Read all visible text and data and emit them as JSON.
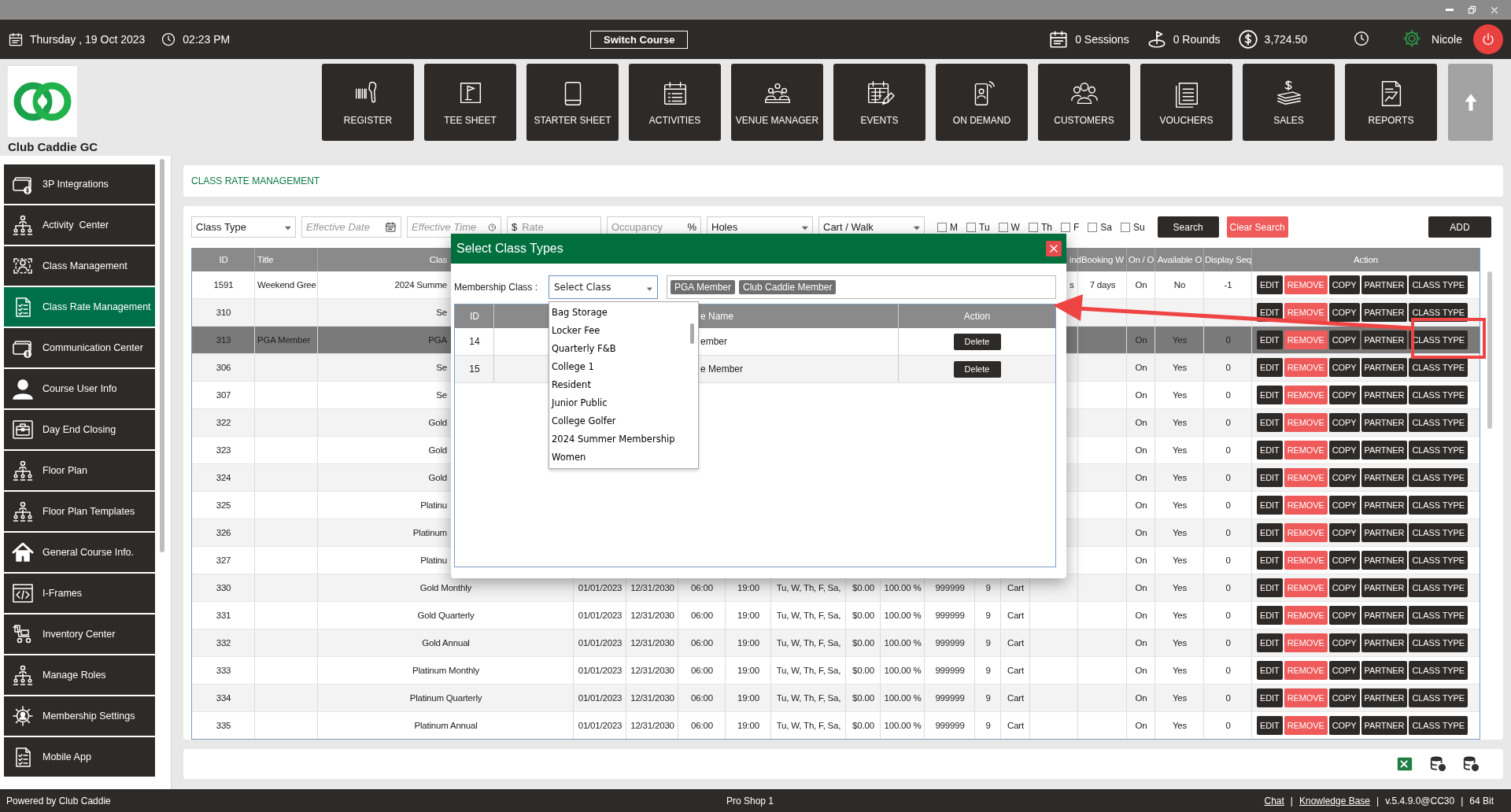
{
  "header": {
    "date": "Thursday , 19 Oct 2023",
    "time": "02:23 PM",
    "switch_course": "Switch Course",
    "sessions": "0 Sessions",
    "rounds": "0 Rounds",
    "balance": "3,724.50",
    "user": "Nicole"
  },
  "brand": {
    "name": "Club Caddie GC"
  },
  "nav": [
    "REGISTER",
    "TEE SHEET",
    "STARTER SHEET",
    "ACTIVITIES",
    "VENUE MANAGER",
    "EVENTS",
    "ON DEMAND",
    "CUSTOMERS",
    "VOUCHERS",
    "SALES",
    "REPORTS"
  ],
  "sidebar": {
    "items": [
      {
        "label": "3P Integrations",
        "selected": false
      },
      {
        "label": "Activity  Center",
        "selected": false
      },
      {
        "label": "Class Management",
        "selected": false
      },
      {
        "label": "Class Rate Management",
        "selected": true
      },
      {
        "label": "Communication Center",
        "selected": false
      },
      {
        "label": "Course User Info",
        "selected": false
      },
      {
        "label": "Day End Closing",
        "selected": false
      },
      {
        "label": "Floor Plan",
        "selected": false
      },
      {
        "label": "Floor Plan Templates",
        "selected": false
      },
      {
        "label": "General Course Info.",
        "selected": false
      },
      {
        "label": "I-Frames",
        "selected": false
      },
      {
        "label": "Inventory Center",
        "selected": false
      },
      {
        "label": "Manage Roles",
        "selected": false
      },
      {
        "label": "Membership Settings",
        "selected": false
      },
      {
        "label": "Mobile App",
        "selected": false
      }
    ]
  },
  "page_title": "CLASS RATE MANAGEMENT",
  "filters": {
    "class_type": "Class Type",
    "effective_date": {
      "placeholder": "Effective Date"
    },
    "effective_time": {
      "placeholder": "Effective Time"
    },
    "rate": {
      "prefix": "$",
      "placeholder": "Rate"
    },
    "occupancy": {
      "placeholder": "Occupancy",
      "suffix": "%"
    },
    "holes": "Holes",
    "cart_walk": "Cart / Walk",
    "days": [
      {
        "label": "M",
        "checked": false
      },
      {
        "label": "Tu",
        "checked": false
      },
      {
        "label": "W",
        "checked": false
      },
      {
        "label": "Th",
        "checked": false
      },
      {
        "label": "F",
        "checked": false
      },
      {
        "label": "Sa",
        "checked": false
      },
      {
        "label": "Su",
        "checked": false
      }
    ],
    "search": "Search",
    "clear_search": "Clear Search",
    "add": "ADD"
  },
  "table": {
    "columns": [
      "ID",
      "Title",
      "Clas",
      "ind",
      "Booking W",
      "On / O",
      "Available O",
      "Display Seq",
      "Action"
    ],
    "rows": [
      {
        "id": "1591",
        "title": "Weekend Gree",
        "class": "2024 Summe",
        "column_14": "s",
        "column_15": "7 days",
        "column_16": "On",
        "column_17": "No",
        "column_18": "-1",
        "selected": false,
        "actions": [
          {
            "label": "EDIT",
            "kind": "dark"
          },
          {
            "label": "REMOVE",
            "kind": "danger"
          },
          {
            "label": "COPY",
            "kind": "dark"
          },
          {
            "label": "PARTNER",
            "kind": "dark"
          },
          {
            "label": "CLASS TYPE",
            "kind": "dark"
          }
        ]
      },
      {
        "id": "310",
        "class": "Se",
        "selected": false,
        "actions": [
          {
            "label": "EDIT",
            "kind": "dark"
          },
          {
            "label": "REMOVE",
            "kind": "danger"
          },
          {
            "label": "COPY",
            "kind": "dark"
          },
          {
            "label": "PARTNER",
            "kind": "dark"
          },
          {
            "label": "CLASS TYPE",
            "kind": "dark"
          }
        ]
      },
      {
        "id": "313",
        "title": "PGA Member",
        "class": "PGA",
        "column_16": "On",
        "column_17": "Yes",
        "column_18": "0",
        "selected": true,
        "actions": [
          {
            "label": "EDIT",
            "kind": "dark"
          },
          {
            "label": "REMOVE",
            "kind": "danger"
          },
          {
            "label": "COPY",
            "kind": "dark"
          },
          {
            "label": "PARTNER",
            "kind": "dark"
          },
          {
            "label": "CLASS TYPE",
            "kind": "dark"
          }
        ]
      },
      {
        "id": "306",
        "class": "Se",
        "column_16": "On",
        "column_17": "Yes",
        "column_18": "0",
        "selected": false,
        "actions": [
          {
            "label": "EDIT",
            "kind": "dark"
          },
          {
            "label": "REMOVE",
            "kind": "danger"
          },
          {
            "label": "COPY",
            "kind": "dark"
          },
          {
            "label": "PARTNER",
            "kind": "dark"
          },
          {
            "label": "CLASS TYPE",
            "kind": "dark"
          }
        ]
      },
      {
        "id": "307",
        "class": "Se",
        "column_16": "On",
        "column_17": "Yes",
        "column_18": "0",
        "selected": false,
        "actions": [
          {
            "label": "EDIT",
            "kind": "dark"
          },
          {
            "label": "REMOVE",
            "kind": "danger"
          },
          {
            "label": "COPY",
            "kind": "dark"
          },
          {
            "label": "PARTNER",
            "kind": "dark"
          },
          {
            "label": "CLASS TYPE",
            "kind": "dark"
          }
        ]
      },
      {
        "id": "322",
        "class": "Gold",
        "column_16": "On",
        "column_17": "Yes",
        "column_18": "0",
        "selected": false,
        "actions": [
          {
            "label": "EDIT",
            "kind": "dark"
          },
          {
            "label": "REMOVE",
            "kind": "danger"
          },
          {
            "label": "COPY",
            "kind": "dark"
          },
          {
            "label": "PARTNER",
            "kind": "dark"
          },
          {
            "label": "CLASS TYPE",
            "kind": "dark"
          }
        ]
      },
      {
        "id": "323",
        "class": "Gold",
        "column_16": "On",
        "column_17": "Yes",
        "column_18": "0",
        "selected": false,
        "actions": [
          {
            "label": "EDIT",
            "kind": "dark"
          },
          {
            "label": "REMOVE",
            "kind": "danger"
          },
          {
            "label": "COPY",
            "kind": "dark"
          },
          {
            "label": "PARTNER",
            "kind": "dark"
          },
          {
            "label": "CLASS TYPE",
            "kind": "dark"
          }
        ]
      },
      {
        "id": "324",
        "class": "Gold",
        "column_16": "On",
        "column_17": "Yes",
        "column_18": "0",
        "selected": false,
        "actions": [
          {
            "label": "EDIT",
            "kind": "dark"
          },
          {
            "label": "REMOVE",
            "kind": "danger"
          },
          {
            "label": "COPY",
            "kind": "dark"
          },
          {
            "label": "PARTNER",
            "kind": "dark"
          },
          {
            "label": "CLASS TYPE",
            "kind": "dark"
          }
        ]
      },
      {
        "id": "325",
        "class": "Platinu",
        "column_16": "On",
        "column_17": "Yes",
        "column_18": "0",
        "selected": false,
        "actions": [
          {
            "label": "EDIT",
            "kind": "dark"
          },
          {
            "label": "REMOVE",
            "kind": "danger"
          },
          {
            "label": "COPY",
            "kind": "dark"
          },
          {
            "label": "PARTNER",
            "kind": "dark"
          },
          {
            "label": "CLASS TYPE",
            "kind": "dark"
          }
        ]
      },
      {
        "id": "326",
        "class": "Platinum",
        "column_16": "On",
        "column_17": "Yes",
        "column_18": "0",
        "selected": false,
        "actions": [
          {
            "label": "EDIT",
            "kind": "dark"
          },
          {
            "label": "REMOVE",
            "kind": "danger"
          },
          {
            "label": "COPY",
            "kind": "dark"
          },
          {
            "label": "PARTNER",
            "kind": "dark"
          },
          {
            "label": "CLASS TYPE",
            "kind": "dark"
          }
        ]
      },
      {
        "id": "327",
        "class": "Platinu",
        "column_16": "On",
        "column_17": "Yes",
        "column_18": "0",
        "selected": false,
        "actions": [
          {
            "label": "EDIT",
            "kind": "dark"
          },
          {
            "label": "REMOVE",
            "kind": "danger"
          },
          {
            "label": "COPY",
            "kind": "dark"
          },
          {
            "label": "PARTNER",
            "kind": "dark"
          },
          {
            "label": "CLASS TYPE",
            "kind": "dark"
          }
        ]
      },
      {
        "id": "330",
        "class": "Gold Monthly",
        "column_4": "01/01/2023",
        "column_5": "12/31/2030",
        "column_6": "06:00",
        "column_7": "19:00",
        "column_8": "Tu, W, Th, F, Sa,",
        "column_9": "$0.00",
        "column_10": "100.00 %",
        "column_11": "999999",
        "column_12": "9",
        "column_13": "Cart",
        "column_16": "On",
        "column_17": "Yes",
        "column_18": "0",
        "selected": false,
        "actions": [
          {
            "label": "EDIT",
            "kind": "dark"
          },
          {
            "label": "REMOVE",
            "kind": "danger"
          },
          {
            "label": "COPY",
            "kind": "dark"
          },
          {
            "label": "PARTNER",
            "kind": "dark"
          },
          {
            "label": "CLASS TYPE",
            "kind": "dark"
          }
        ]
      },
      {
        "id": "331",
        "class": "Gold Quarterly",
        "column_4": "01/01/2023",
        "column_5": "12/31/2030",
        "column_6": "06:00",
        "column_7": "19:00",
        "column_8": "Tu, W, Th, F, Sa,",
        "column_9": "$0.00",
        "column_10": "100.00 %",
        "column_11": "999999",
        "column_12": "9",
        "column_13": "Cart",
        "column_16": "On",
        "column_17": "Yes",
        "column_18": "0",
        "selected": false,
        "actions": [
          {
            "label": "EDIT",
            "kind": "dark"
          },
          {
            "label": "REMOVE",
            "kind": "danger"
          },
          {
            "label": "COPY",
            "kind": "dark"
          },
          {
            "label": "PARTNER",
            "kind": "dark"
          },
          {
            "label": "CLASS TYPE",
            "kind": "dark"
          }
        ]
      },
      {
        "id": "332",
        "class": "Gold Annual",
        "column_4": "01/01/2023",
        "column_5": "12/31/2030",
        "column_6": "06:00",
        "column_7": "19:00",
        "column_8": "Tu, W, Th, F, Sa,",
        "column_9": "$0.00",
        "column_10": "100.00 %",
        "column_11": "999999",
        "column_12": "9",
        "column_13": "Cart",
        "column_16": "On",
        "column_17": "Yes",
        "column_18": "0",
        "selected": false,
        "actions": [
          {
            "label": "EDIT",
            "kind": "dark"
          },
          {
            "label": "REMOVE",
            "kind": "danger"
          },
          {
            "label": "COPY",
            "kind": "dark"
          },
          {
            "label": "PARTNER",
            "kind": "dark"
          },
          {
            "label": "CLASS TYPE",
            "kind": "dark"
          }
        ]
      },
      {
        "id": "333",
        "class": "Platinum Monthly",
        "column_4": "01/01/2023",
        "column_5": "12/31/2030",
        "column_6": "06:00",
        "column_7": "19:00",
        "column_8": "Tu, W, Th, F, Sa,",
        "column_9": "$0.00",
        "column_10": "100.00 %",
        "column_11": "999999",
        "column_12": "9",
        "column_13": "Cart",
        "column_16": "On",
        "column_17": "Yes",
        "column_18": "0",
        "selected": false,
        "actions": [
          {
            "label": "EDIT",
            "kind": "dark"
          },
          {
            "label": "REMOVE",
            "kind": "danger"
          },
          {
            "label": "COPY",
            "kind": "dark"
          },
          {
            "label": "PARTNER",
            "kind": "dark"
          },
          {
            "label": "CLASS TYPE",
            "kind": "dark"
          }
        ]
      },
      {
        "id": "334",
        "class": "Platinum Quarterly",
        "column_4": "01/01/2023",
        "column_5": "12/31/2030",
        "column_6": "06:00",
        "column_7": "19:00",
        "column_8": "Tu, W, Th, F, Sa,",
        "column_9": "$0.00",
        "column_10": "100.00 %",
        "column_11": "999999",
        "column_12": "9",
        "column_13": "Cart",
        "column_16": "On",
        "column_17": "Yes",
        "column_18": "0",
        "selected": false,
        "actions": [
          {
            "label": "EDIT",
            "kind": "dark"
          },
          {
            "label": "REMOVE",
            "kind": "danger"
          },
          {
            "label": "COPY",
            "kind": "dark"
          },
          {
            "label": "PARTNER",
            "kind": "dark"
          },
          {
            "label": "CLASS TYPE",
            "kind": "dark"
          }
        ]
      },
      {
        "id": "335",
        "class": "Platinum Annual",
        "column_4": "01/01/2023",
        "column_5": "12/31/2030",
        "column_6": "06:00",
        "column_7": "19:00",
        "column_8": "Tu, W, Th, F, Sa,",
        "column_9": "$0.00",
        "column_10": "100.00 %",
        "column_11": "999999",
        "column_12": "9",
        "column_13": "Cart",
        "column_16": "On",
        "column_17": "Yes",
        "column_18": "0",
        "selected": false,
        "actions": [
          {
            "label": "EDIT",
            "kind": "dark"
          },
          {
            "label": "REMOVE",
            "kind": "danger"
          },
          {
            "label": "COPY",
            "kind": "dark"
          },
          {
            "label": "PARTNER",
            "kind": "dark"
          },
          {
            "label": "CLASS TYPE",
            "kind": "dark"
          }
        ]
      }
    ]
  },
  "dialog": {
    "title": "Select Class Types",
    "membership_class": {
      "label": "Membership Class :",
      "value": "Select Class",
      "expanded": true,
      "options": [
        "Bag Storage",
        "Locker Fee",
        "Quarterly F&B",
        "College 1",
        "Resident",
        "Junior Public",
        "College Golfer",
        "2024 Summer Membership",
        "Women"
      ]
    },
    "tags": [
      "PGA Member",
      "Club Caddie Member"
    ],
    "columns": [
      "ID",
      "e Name",
      "Action"
    ],
    "rows": [
      {
        "id": "14",
        "name": "ember",
        "action": "Delete"
      },
      {
        "id": "15",
        "name": "e Member",
        "action": "Delete"
      }
    ]
  },
  "footer": {
    "left": "Powered by Club Caddie",
    "center": "Pro Shop 1",
    "right": [
      {
        "text": "Chat",
        "kind": "link"
      },
      {
        "text": "|",
        "kind": "separator"
      },
      {
        "text": "Knowledge Base",
        "kind": "link"
      },
      {
        "text": "|",
        "kind": "separator"
      },
      {
        "text": "v.5.4.9.0@CC30",
        "kind": "text"
      },
      {
        "text": "|",
        "kind": "separator"
      },
      {
        "text": "64 Bit",
        "kind": "text"
      }
    ]
  }
}
